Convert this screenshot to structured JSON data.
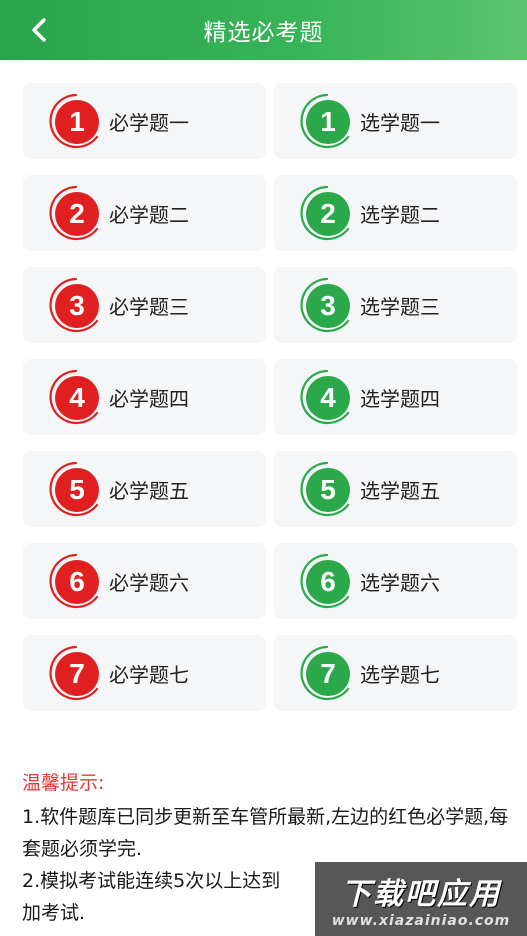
{
  "header": {
    "title": "精选必考题"
  },
  "colors": {
    "required": "#e02020",
    "elective": "#2aa84a"
  },
  "required_items": [
    {
      "num": "1",
      "label": "必学题一"
    },
    {
      "num": "2",
      "label": "必学题二"
    },
    {
      "num": "3",
      "label": "必学题三"
    },
    {
      "num": "4",
      "label": "必学题四"
    },
    {
      "num": "5",
      "label": "必学题五"
    },
    {
      "num": "6",
      "label": "必学题六"
    },
    {
      "num": "7",
      "label": "必学题七"
    }
  ],
  "elective_items": [
    {
      "num": "1",
      "label": "选学题一"
    },
    {
      "num": "2",
      "label": "选学题二"
    },
    {
      "num": "3",
      "label": "选学题三"
    },
    {
      "num": "4",
      "label": "选学题四"
    },
    {
      "num": "5",
      "label": "选学题五"
    },
    {
      "num": "6",
      "label": "选学题六"
    },
    {
      "num": "7",
      "label": "选学题七"
    }
  ],
  "tips": {
    "title": "温馨提示:",
    "line1": "1.软件题库已同步更新至车管所最新,左边的红色必学题,每套题必须学完.",
    "line2": "2.模拟考试能连续5次以上达到",
    "line2_end": "加考试."
  },
  "watermark": {
    "main": "下载吧应用",
    "url": "www.xiazainiao.com"
  }
}
